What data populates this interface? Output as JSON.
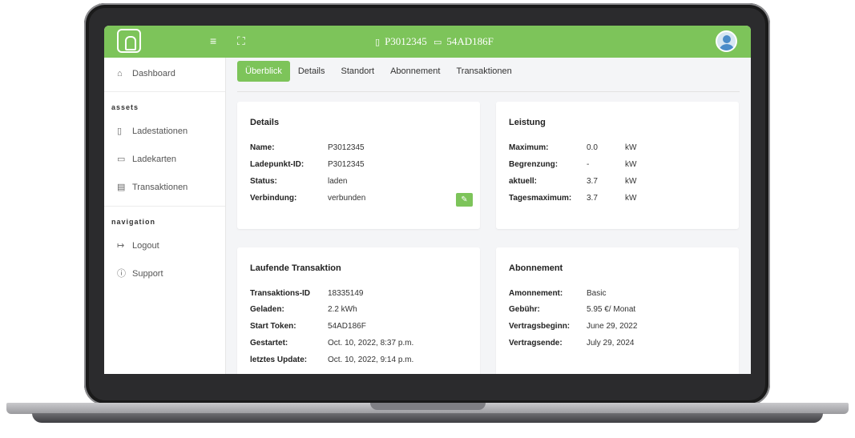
{
  "topbar": {
    "station_id": "P3012345",
    "card_id": "54AD186F"
  },
  "sidebar": {
    "dashboard": "Dashboard",
    "section_assets": "assets",
    "assets": [
      "Ladestationen",
      "Ladekarten",
      "Transaktionen"
    ],
    "section_navigation": "navigation",
    "navigation": [
      "Logout",
      "Support"
    ]
  },
  "tabs": [
    "Überblick",
    "Details",
    "Standort",
    "Abonnement",
    "Transaktionen"
  ],
  "details": {
    "title": "Details",
    "rows": [
      {
        "k": "Name:",
        "v": "P3012345"
      },
      {
        "k": "Ladepunkt-ID:",
        "v": "P3012345"
      },
      {
        "k": "Status:",
        "v": "laden"
      },
      {
        "k": "Verbindung:",
        "v": "verbunden"
      }
    ]
  },
  "leistung": {
    "title": "Leistung",
    "rows": [
      {
        "k": "Maximum:",
        "v": "0.0",
        "u": "kW"
      },
      {
        "k": "Begrenzung:",
        "v": "-",
        "u": "kW"
      },
      {
        "k": "aktuell:",
        "v": "3.7",
        "u": "kW"
      },
      {
        "k": "Tagesmaximum:",
        "v": "3.7",
        "u": "kW"
      }
    ]
  },
  "transaktion": {
    "title": "Laufende Transaktion",
    "rows": [
      {
        "k": "Transaktions-ID",
        "v": "18335149"
      },
      {
        "k": "Geladen:",
        "v": "2.2 kWh"
      },
      {
        "k": "Start Token:",
        "v": "54AD186F"
      },
      {
        "k": "Gestartet:",
        "v": "Oct. 10, 2022, 8:37 p.m."
      },
      {
        "k": "letztes Update:",
        "v": "Oct. 10, 2022, 9:14 p.m."
      }
    ]
  },
  "abonnement": {
    "title": "Abonnement",
    "rows": [
      {
        "k": "Amonnement:",
        "v": "Basic"
      },
      {
        "k": "Gebühr:",
        "v": "5.95 €/ Monat"
      },
      {
        "k": "Vertragsbeginn:",
        "v": "June 29, 2022"
      },
      {
        "k": "Vertragsende:",
        "v": "July 29, 2024"
      }
    ]
  },
  "colors": {
    "accent": "#7dc45a",
    "background": "#f4f5f7"
  },
  "icons": [
    "logo-icon",
    "menu-icon",
    "fullscreen-icon",
    "phone-icon",
    "card-icon",
    "avatar-icon",
    "home-icon",
    "edit-icon"
  ]
}
